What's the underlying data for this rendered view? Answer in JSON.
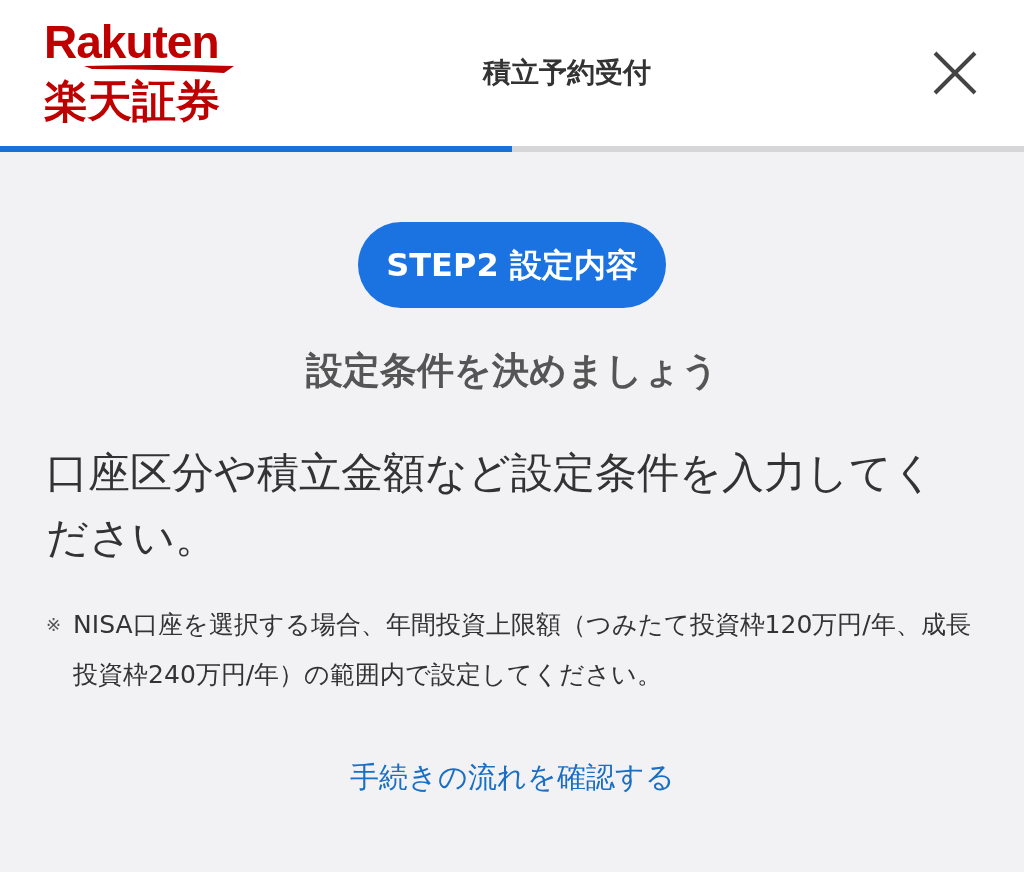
{
  "header": {
    "logo_latin": "Rakuten",
    "logo_japanese": "楽天証券",
    "title": "積立予約受付"
  },
  "progress": {
    "level": 0.5
  },
  "step_badge": "STEP2 設定内容",
  "heading": "設定条件を決めましょう",
  "description": "口座区分や積立金額など設定条件を入力してください。",
  "note": {
    "mark": "※",
    "text": "NISA口座を選択する場合、年間投資上限額（つみたて投資枠120万円/年、成長投資枠240万円/年）の範囲内で設定してください。"
  },
  "link": "手続きの流れを確認する"
}
